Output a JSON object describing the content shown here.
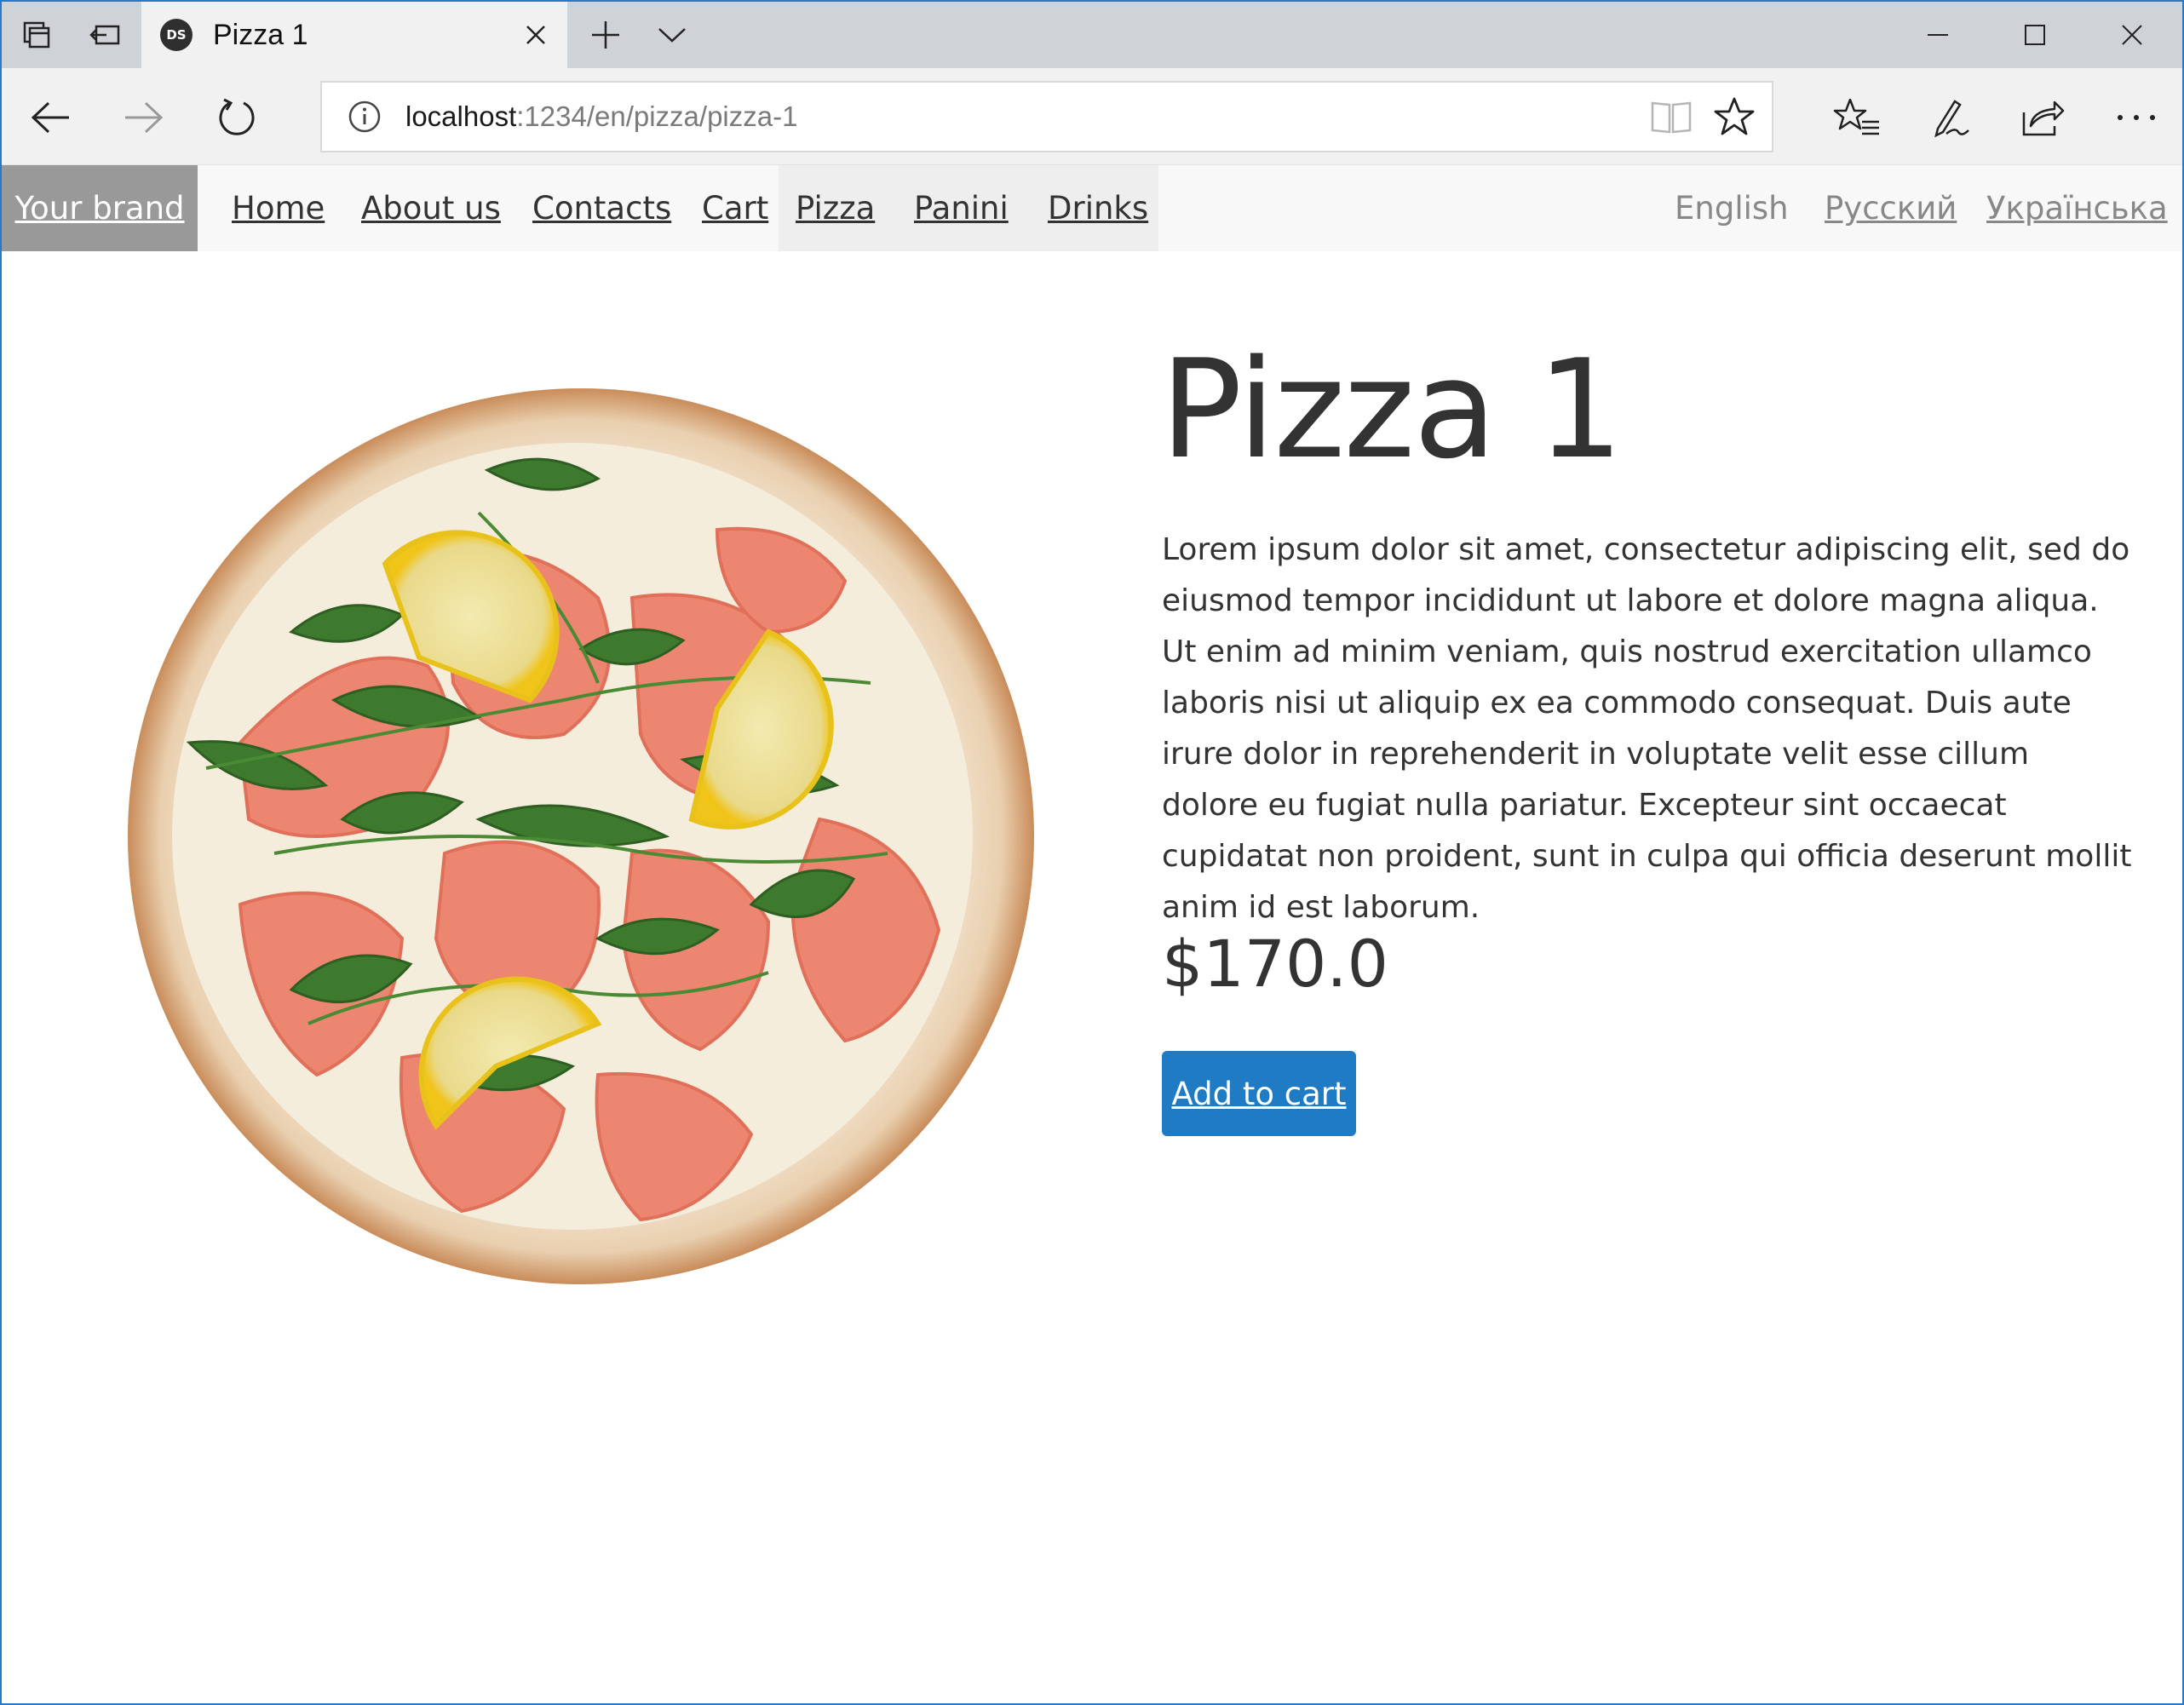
{
  "browser": {
    "tab_title": "Pizza 1",
    "favicon_text": "DS",
    "url_host": "localhost",
    "url_path": ":1234/en/pizza/pizza-1"
  },
  "site": {
    "brand": "Your brand",
    "menu": [
      "Home",
      "About us",
      "Contacts",
      "Cart",
      "Pizza",
      "Panini",
      "Drinks"
    ],
    "active_menu": "Pizza",
    "languages": [
      "English",
      "Русский",
      "Українська"
    ],
    "current_language": "English"
  },
  "product": {
    "title": "Pizza 1",
    "description": "Lorem ipsum dolor sit amet, consectetur adipiscing elit, sed do eiusmod tempor incididunt ut labore et dolore magna aliqua. Ut enim ad minim veniam, quis nostrud exercitation ullamco laboris nisi ut aliquip ex ea commodo consequat. Duis aute irure dolor in reprehenderit in voluptate velit esse cillum dolore eu fugiat nulla pariatur. Excepteur sint occaecat cupidatat non proident, sunt in culpa qui officia deserunt mollit anim id est laborum.",
    "price": "$170.0",
    "add_to_cart_label": "Add to cart"
  },
  "colors": {
    "accent": "#1e7bc4",
    "brand_bg": "#999999"
  }
}
